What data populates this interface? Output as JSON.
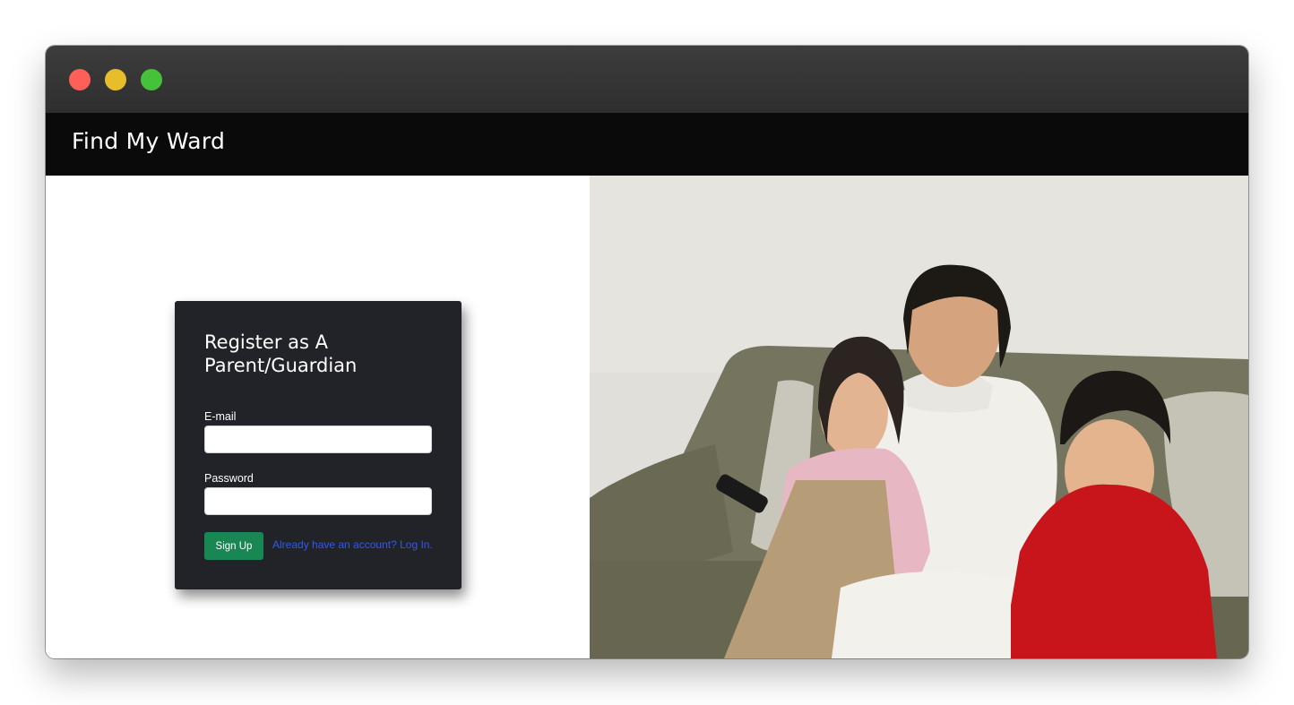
{
  "window": {
    "controls": [
      "close-icon",
      "minimize-icon",
      "maximize-icon"
    ]
  },
  "navbar": {
    "brand": "Find My Ward"
  },
  "register_form": {
    "title": "Register as A Parent/Guardian",
    "email_label": "E-mail",
    "email_value": "",
    "password_label": "Password",
    "password_value": "",
    "submit_label": "Sign Up",
    "login_link": "Already have an account? Log In."
  },
  "colors": {
    "navbar_bg": "#0a0a0a",
    "card_bg": "#212329",
    "primary_button": "#198754",
    "link": "#2f5bea",
    "close": "#fe5f57",
    "minimize": "#e8bd2c",
    "maximize": "#45c23a"
  }
}
